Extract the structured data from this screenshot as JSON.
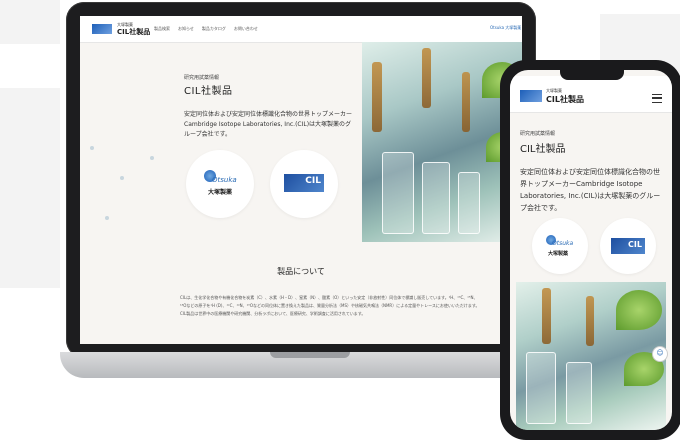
{
  "site": {
    "brand_small": "大塚製薬",
    "brand_name": "CIL社製品",
    "nav": [
      "製品検索",
      "お知らせ",
      "製品カタログ",
      "お問い合わせ"
    ],
    "partner_logo": "Otsuka 大塚製薬"
  },
  "hero": {
    "sublabel": "研究用試薬情報",
    "title": "CIL社製品",
    "description": "安定同位体および安定同位体標識化合物の世界トップメーカーCambridge Isotope Laboratories, Inc.(CIL)は大塚製薬のグループ会社です。"
  },
  "logos": {
    "otsuka_en": "Otsuka",
    "otsuka_jp": "大塚製薬",
    "cil": "CIL"
  },
  "section": {
    "heading": "製品について",
    "body": "CILは、生化学化合物や有機化合物を炭素（C）、水素（H・D）、窒素（N）、酸素（O）といった安定（非放射性）同位体で標識し販売しています。²H、¹³C、¹⁵N、¹⁸Oなどの原子を¹H (D)、¹²C、¹⁴N、¹⁶Oなどの同位体に置き換えた製品は、質量分析法（MS）や核磁気共鳴法（NMR）による定量やトレースにお使いいただけます。CIL製品は世界中の医療機関や研究機関、分析ラボにおいて、医療研究、学術調査に活用されています。"
  },
  "phone": {
    "chat_icon": "chat-icon"
  },
  "colors": {
    "accent": "#1d5fb8",
    "frame": "#1d1d1f",
    "page_bg": "#f7f5f2"
  }
}
